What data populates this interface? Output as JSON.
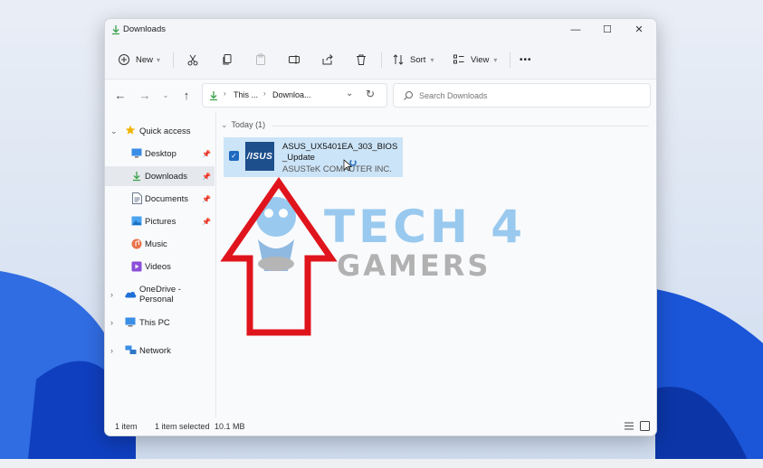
{
  "window": {
    "title": "Downloads"
  },
  "toolbar": {
    "new_label": "New",
    "sort_label": "Sort",
    "view_label": "View",
    "more_label": "•••"
  },
  "address": {
    "path_short": "This ...",
    "path_current": "Downloa...",
    "search_placeholder": "Search Downloads"
  },
  "sidebar": {
    "items": [
      {
        "label": "Quick access",
        "icon": "star-icon"
      },
      {
        "label": "Desktop",
        "icon": "desktop-icon"
      },
      {
        "label": "Downloads",
        "icon": "download-icon"
      },
      {
        "label": "Documents",
        "icon": "documents-icon"
      },
      {
        "label": "Pictures",
        "icon": "pictures-icon"
      },
      {
        "label": "Music",
        "icon": "music-icon"
      },
      {
        "label": "Videos",
        "icon": "videos-icon"
      },
      {
        "label": "OneDrive - Personal",
        "icon": "onedrive-icon"
      },
      {
        "label": "This PC",
        "icon": "this-pc-icon"
      },
      {
        "label": "Network",
        "icon": "network-icon"
      }
    ]
  },
  "content": {
    "group_header": "Today (1)",
    "file": {
      "name": "ASUS_UX5401EA_303_BIOS_Update",
      "publisher": "ASUSTeK COMPUTER INC.",
      "thumb_text": "/ISUS"
    }
  },
  "status": {
    "count": "1 item",
    "selected": "1 item selected",
    "size": "10.1 MB"
  },
  "watermark": {
    "line1": "TECH 4",
    "line2": "GAMERS"
  },
  "colors": {
    "accent": "#1e6ac0",
    "selection": "#cce4f7",
    "annotation_arrow": "#e0141c",
    "watermark": "#5aa9e6"
  }
}
